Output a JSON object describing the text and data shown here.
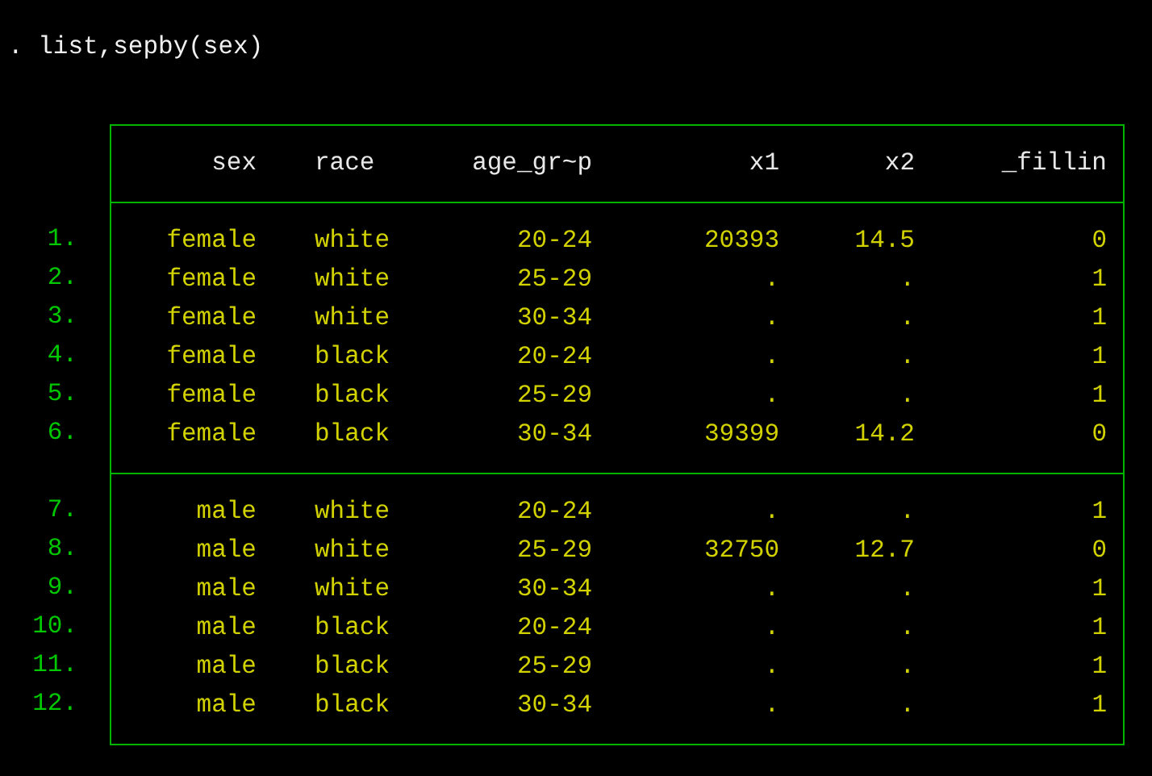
{
  "command": ". list,sepby(sex)",
  "columns": [
    "sex",
    "race",
    "age_gr~p",
    "x1",
    "x2",
    "_fillin"
  ],
  "groups": [
    {
      "rows": [
        {
          "number": "1.",
          "cells": [
            "female",
            "white",
            "20-24",
            "20393",
            "14.5",
            "0"
          ]
        },
        {
          "number": "2.",
          "cells": [
            "female",
            "white",
            "25-29",
            ".",
            ".",
            "1"
          ]
        },
        {
          "number": "3.",
          "cells": [
            "female",
            "white",
            "30-34",
            ".",
            ".",
            "1"
          ]
        },
        {
          "number": "4.",
          "cells": [
            "female",
            "black",
            "20-24",
            ".",
            ".",
            "1"
          ]
        },
        {
          "number": "5.",
          "cells": [
            "female",
            "black",
            "25-29",
            ".",
            ".",
            "1"
          ]
        },
        {
          "number": "6.",
          "cells": [
            "female",
            "black",
            "30-34",
            "39399",
            "14.2",
            "0"
          ]
        }
      ]
    },
    {
      "rows": [
        {
          "number": "7.",
          "cells": [
            "male",
            "white",
            "20-24",
            ".",
            ".",
            "1"
          ]
        },
        {
          "number": "8.",
          "cells": [
            "male",
            "white",
            "25-29",
            "32750",
            "12.7",
            "0"
          ]
        },
        {
          "number": "9.",
          "cells": [
            "male",
            "white",
            "30-34",
            ".",
            ".",
            "1"
          ]
        },
        {
          "number": "10.",
          "cells": [
            "male",
            "black",
            "20-24",
            ".",
            ".",
            "1"
          ]
        },
        {
          "number": "11.",
          "cells": [
            "male",
            "black",
            "25-29",
            ".",
            ".",
            "1"
          ]
        },
        {
          "number": "12.",
          "cells": [
            "male",
            "black",
            "30-34",
            ".",
            ".",
            "1"
          ]
        }
      ]
    }
  ]
}
